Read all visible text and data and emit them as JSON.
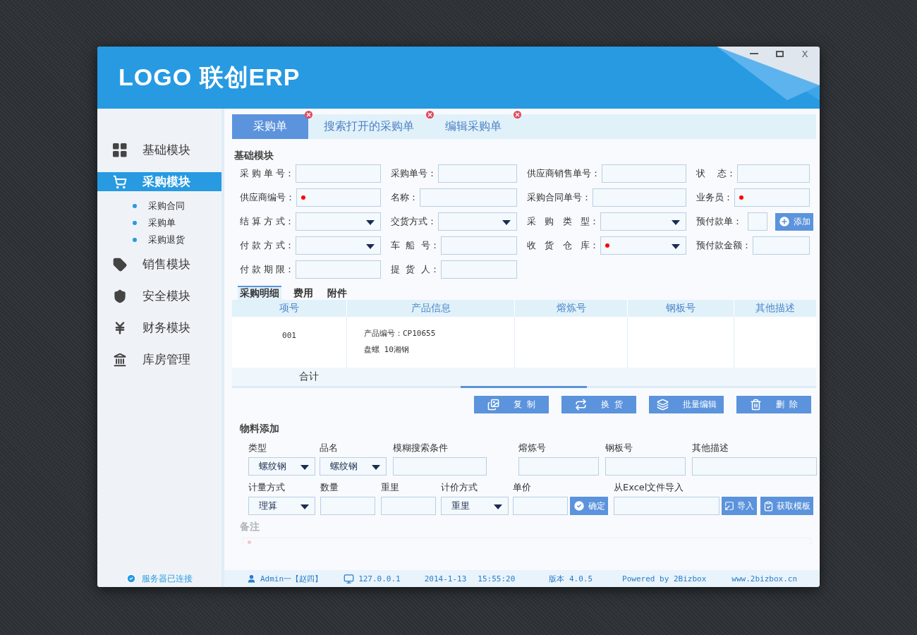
{
  "header": {
    "logo": "LOGO 联创ERP",
    "close": "X"
  },
  "sidebar": {
    "items": [
      {
        "label": "基础模块",
        "kind": "grid",
        "selected": false
      },
      {
        "label": "采购模块",
        "kind": "cart",
        "selected": true,
        "expanded": true,
        "children": [
          {
            "label": "采购合同"
          },
          {
            "label": "采购单"
          },
          {
            "label": "采购退货"
          }
        ]
      },
      {
        "label": "销售模块",
        "kind": "tag",
        "selected": false
      },
      {
        "label": "安全模块",
        "kind": "shield",
        "selected": false
      },
      {
        "label": "财务模块",
        "kind": "yen",
        "selected": false
      },
      {
        "label": "库房管理",
        "kind": "bank",
        "selected": false
      }
    ],
    "status": "服务器已连接"
  },
  "tabs": [
    {
      "label": "采购单",
      "selected": true
    },
    {
      "label": "搜索打开的采购单",
      "selected": false
    },
    {
      "label": "编辑采购单",
      "selected": false
    }
  ],
  "basic": {
    "title": "基础模块",
    "fields": [
      {
        "label": "采 购 单 号：",
        "kind": "text",
        "required": false
      },
      {
        "label": "采购单号：",
        "kind": "text",
        "required": false
      },
      {
        "label": "供应商销售单号：",
        "kind": "text",
        "required": false
      },
      {
        "label": "状    态：",
        "kind": "text",
        "required": false
      },
      {
        "label": "供应商编号：",
        "kind": "text",
        "required": true
      },
      {
        "label": "名称：",
        "kind": "text",
        "required": false
      },
      {
        "label": "采购合同单号：",
        "kind": "text",
        "required": false
      },
      {
        "label": "业务员：",
        "kind": "text",
        "required": true
      },
      {
        "label": "结 算 方 式：",
        "kind": "select",
        "required": false
      },
      {
        "label": "交货方式：",
        "kind": "select",
        "required": false
      },
      {
        "label": "采   购   类   型：",
        "kind": "select",
        "required": false
      },
      {
        "label": "预付款单：",
        "kind": "add",
        "required": false,
        "button": "添加"
      },
      {
        "label": "付 款 方 式：",
        "kind": "select",
        "required": false
      },
      {
        "label": "车  船  号：",
        "kind": "text",
        "required": false
      },
      {
        "label": "收   货   仓   库：",
        "kind": "select",
        "required": true
      },
      {
        "label": "预付款金额：",
        "kind": "text",
        "required": false
      },
      {
        "label": "付 款 期 限：",
        "kind": "text",
        "required": false
      },
      {
        "label": "提  货  人：",
        "kind": "text",
        "required": false
      }
    ]
  },
  "detail_tabs": [
    {
      "label": "采购明细",
      "selected": true
    },
    {
      "label": "费用",
      "selected": false
    },
    {
      "label": "附件",
      "selected": false
    }
  ],
  "table": {
    "columns": [
      "项号",
      "产品信息",
      "熔炼号",
      "钢板号",
      "其他描述"
    ],
    "rows": [
      {
        "item": "001",
        "product": [
          "产品编号：CP10655",
          "盘螺 10湘钢"
        ]
      }
    ],
    "total": "合计"
  },
  "actions": [
    {
      "label": "复  制",
      "kind": "copy"
    },
    {
      "label": "换  货",
      "kind": "swap"
    },
    {
      "label": "批量编辑",
      "kind": "layers"
    },
    {
      "label": "删  除",
      "kind": "trash"
    }
  ],
  "material": {
    "title": "物料添加",
    "first_line": [
      {
        "label": "类型",
        "kind": "select",
        "value": "螺纹钢"
      },
      {
        "label": "品名",
        "kind": "select",
        "value": "螺纹钢"
      },
      {
        "label": "模糊搜索条件",
        "kind": "text"
      },
      {
        "label": "熔炼号",
        "kind": "text"
      },
      {
        "label": "钢板号",
        "kind": "text"
      },
      {
        "label": "其他描述",
        "kind": "text"
      }
    ],
    "second_line": [
      {
        "label": "计量方式",
        "kind": "select",
        "value": "理算"
      },
      {
        "label": "数量",
        "kind": "text"
      },
      {
        "label": "重里",
        "kind": "text"
      },
      {
        "label": "计价方式",
        "kind": "select",
        "value": "重里"
      },
      {
        "label": "单价",
        "kind": "text",
        "buttons": [
          {
            "label": "确定",
            "kind": "check"
          }
        ]
      },
      {
        "label": "从Excel文件导入",
        "kind": "text",
        "buttons": [
          {
            "label": "导入",
            "kind": "import"
          },
          {
            "label": "获取模板",
            "kind": "template"
          }
        ]
      }
    ],
    "remark": {
      "label": "备注",
      "disabled": true,
      "required": true
    }
  },
  "status_bar": [
    {
      "text": "Admin一【赵四】",
      "kind": "user"
    },
    {
      "text": "127.0.0.1",
      "kind": "monitor"
    },
    {
      "text": "2014-1-13",
      "kind": "text"
    },
    {
      "text": "15:55:20",
      "kind": "text"
    },
    {
      "text": "版本 4.0.5",
      "kind": "text"
    },
    {
      "text": "Powered by 2Bizbox",
      "kind": "text"
    },
    {
      "text": "www.2bizbox.cn",
      "kind": "text"
    }
  ]
}
